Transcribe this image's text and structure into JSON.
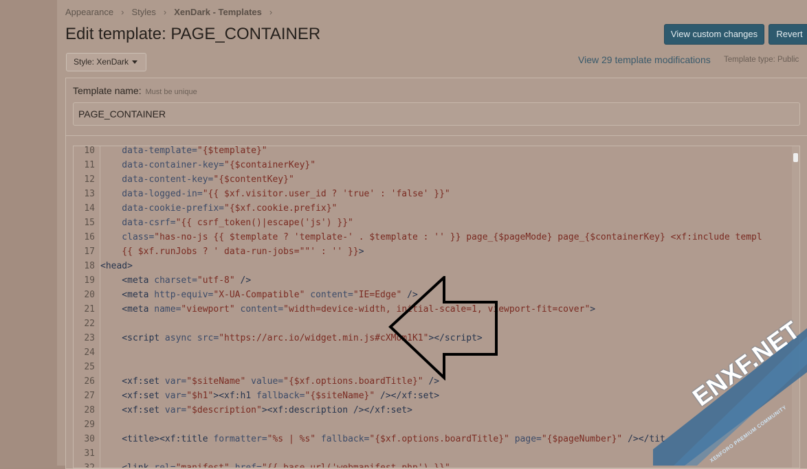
{
  "breadcrumb": [
    "Appearance",
    "Styles",
    "XenDark - Templates"
  ],
  "header": {
    "title": "Edit template: PAGE_CONTAINER",
    "view_custom_changes": "View custom changes",
    "revert": "Revert"
  },
  "style_button": "Style: XenDark",
  "modifications_link": "View 29 template modifications",
  "template_type": "Template type: Public",
  "template_name": {
    "label": "Template name:",
    "hint": "Must be unique",
    "value": "PAGE_CONTAINER"
  },
  "code_lines": [
    {
      "n": "10",
      "parts": [
        [
          "at",
          "    data-template="
        ],
        [
          "st",
          "\"{$template}\""
        ]
      ]
    },
    {
      "n": "11",
      "parts": [
        [
          "at",
          "    data-container-key="
        ],
        [
          "st",
          "\"{$containerKey}\""
        ]
      ]
    },
    {
      "n": "12",
      "parts": [
        [
          "at",
          "    data-content-key="
        ],
        [
          "st",
          "\"{$contentKey}\""
        ]
      ]
    },
    {
      "n": "13",
      "parts": [
        [
          "at",
          "    data-logged-in="
        ],
        [
          "st",
          "\"{{ $xf.visitor.user_id ? 'true' : 'false' }}\""
        ]
      ]
    },
    {
      "n": "14",
      "parts": [
        [
          "at",
          "    data-cookie-prefix="
        ],
        [
          "st",
          "\"{$xf.cookie.prefix}\""
        ]
      ]
    },
    {
      "n": "15",
      "parts": [
        [
          "at",
          "    data-csrf="
        ],
        [
          "st",
          "\"{{ csrf_token()|escape('js') }}\""
        ]
      ]
    },
    {
      "n": "16",
      "parts": [
        [
          "at",
          "    class="
        ],
        [
          "st",
          "\"has-no-js {{ $template ? 'template-' . $template : '' }} page_{$pageMode} page_{$containerKey} <xf:include templ"
        ]
      ]
    },
    {
      "n": "17",
      "parts": [
        [
          "st",
          "    {{ $xf.runJobs ? ' data-run-jobs=\"\"' : '' }}"
        ],
        [
          "tg",
          ">"
        ]
      ]
    },
    {
      "n": "18",
      "parts": [
        [
          "tg",
          "<head>"
        ]
      ]
    },
    {
      "n": "19",
      "parts": [
        [
          "tg",
          "    <meta "
        ],
        [
          "at",
          "charset="
        ],
        [
          "st",
          "\"utf-8\""
        ],
        [
          "tg",
          " />"
        ]
      ]
    },
    {
      "n": "20",
      "parts": [
        [
          "tg",
          "    <meta "
        ],
        [
          "at",
          "http-equiv="
        ],
        [
          "st",
          "\"X-UA-Compatible\""
        ],
        [
          "at",
          " content="
        ],
        [
          "st",
          "\"IE=Edge\""
        ],
        [
          "tg",
          " />"
        ]
      ]
    },
    {
      "n": "21",
      "parts": [
        [
          "tg",
          "    <meta "
        ],
        [
          "at",
          "name="
        ],
        [
          "st",
          "\"viewport\""
        ],
        [
          "at",
          " content="
        ],
        [
          "st",
          "\"width=device-width, initial-scale=1, viewport-fit=cover\""
        ],
        [
          "tg",
          ">"
        ]
      ]
    },
    {
      "n": "22",
      "parts": []
    },
    {
      "n": "23",
      "parts": [
        [
          "tg",
          "    <script "
        ],
        [
          "at",
          "async src="
        ],
        [
          "st",
          "\"https://arc.io/widget.min.js#cXMom1K1\""
        ],
        [
          "tg",
          "></scr"
        ],
        [
          "tg",
          "ipt>"
        ]
      ]
    },
    {
      "n": "24",
      "parts": []
    },
    {
      "n": "25",
      "parts": []
    },
    {
      "n": "26",
      "parts": [
        [
          "tg",
          "    <xf:set "
        ],
        [
          "at",
          "var="
        ],
        [
          "st",
          "\"$siteName\""
        ],
        [
          "at",
          " value="
        ],
        [
          "st",
          "\"{$xf.options.boardTitle}\""
        ],
        [
          "tg",
          " />"
        ]
      ]
    },
    {
      "n": "27",
      "parts": [
        [
          "tg",
          "    <xf:set "
        ],
        [
          "at",
          "var="
        ],
        [
          "st",
          "\"$h1\""
        ],
        [
          "tg",
          "><xf:h1 "
        ],
        [
          "at",
          "fallback="
        ],
        [
          "st",
          "\"{$siteName}\""
        ],
        [
          "tg",
          " /></xf:set>"
        ]
      ]
    },
    {
      "n": "28",
      "parts": [
        [
          "tg",
          "    <xf:set "
        ],
        [
          "at",
          "var="
        ],
        [
          "st",
          "\"$description\""
        ],
        [
          "tg",
          "><xf:description /></xf:set>"
        ]
      ]
    },
    {
      "n": "29",
      "parts": []
    },
    {
      "n": "30",
      "parts": [
        [
          "tg",
          "    <title><xf:title "
        ],
        [
          "at",
          "formatter="
        ],
        [
          "st",
          "\"%s | %s\""
        ],
        [
          "at",
          " fallback="
        ],
        [
          "st",
          "\"{$xf.options.boardTitle}\""
        ],
        [
          "at",
          " page="
        ],
        [
          "st",
          "\"{$pageNumber}\""
        ],
        [
          "tg",
          " /></tit"
        ]
      ]
    },
    {
      "n": "31",
      "parts": []
    },
    {
      "n": "32",
      "parts": [
        [
          "tg",
          "    <link "
        ],
        [
          "at",
          "rel="
        ],
        [
          "st",
          "\"manifest\""
        ],
        [
          "at",
          " href="
        ],
        [
          "st",
          "\"{{ base_url('webmanifest.php') }}\""
        ]
      ]
    }
  ],
  "watermark": {
    "title": "ENXF.NET",
    "subtitle": "XENFORO PREMIUM COMMUNITY"
  },
  "colors": {
    "primary_button": "#2e5a6e",
    "link": "#3a5a6b",
    "code_string": "#7a2b22",
    "code_tag": "#26344d",
    "watermark_blue": "#3b6b95"
  }
}
